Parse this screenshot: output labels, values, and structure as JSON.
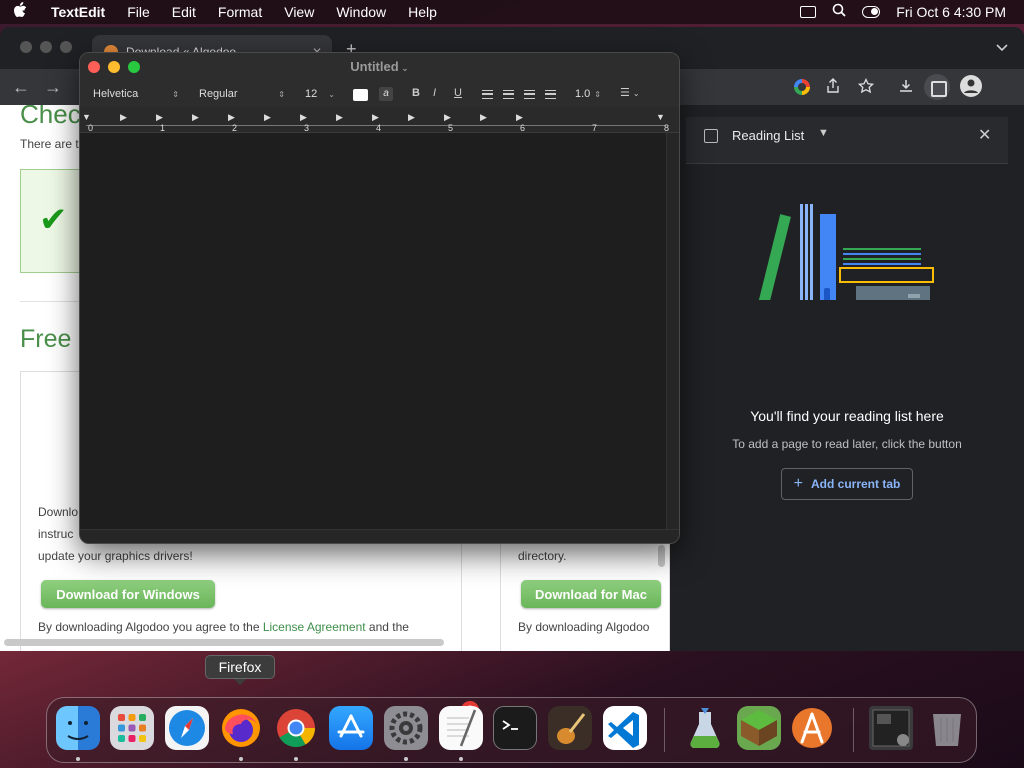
{
  "menubar": {
    "apple_icon": "apple-icon",
    "app_name": "TextEdit",
    "menus": [
      "File",
      "Edit",
      "Format",
      "View",
      "Window",
      "Help"
    ],
    "clock": "Fri Oct 6  4:30 PM"
  },
  "chrome": {
    "tab_title": "Download « Algodoo",
    "tab_close": "✕",
    "new_tab": "+"
  },
  "page": {
    "heading_check": "Chec",
    "para_there": "There are t",
    "heading_free": "Free",
    "win_text_1": "Downlo",
    "win_text_2": "instruc",
    "win_text_3": "update your graphics drivers!",
    "mac_text": "directory.",
    "download_windows": "Download for Windows",
    "download_mac": "Download for Mac",
    "agree_prefix": "By downloading Algodoo you agree to the ",
    "agree_link": "License Agreement",
    "agree_suffix": " and the",
    "agree_mac": "By downloading Algodoo"
  },
  "reading_list": {
    "title": "Reading List",
    "empty_title": "You'll find your reading list here",
    "empty_sub": "To add a page to read later, click the button",
    "add_button": "Add current tab",
    "colors": {
      "green": "#34a853",
      "blue": "#4285f4",
      "yellow": "#fbbc04",
      "grey": "#5f7380"
    }
  },
  "textedit": {
    "title": "Untitled",
    "font_family": "Helvetica",
    "font_style": "Regular",
    "font_size": "12",
    "highlight_glyph": "a",
    "bold": "B",
    "italic": "I",
    "underline": "U",
    "line_spacing": "1.0",
    "ruler_numbers": [
      "0",
      "1",
      "2",
      "3",
      "4",
      "5",
      "6",
      "7",
      "8"
    ]
  },
  "tooltip": {
    "text": "Firefox"
  },
  "dock": {
    "badge_count": "2",
    "apps": [
      "finder-icon",
      "launchpad-icon",
      "safari-icon",
      "firefox-icon",
      "chrome-icon",
      "app-store-icon",
      "system-settings-icon",
      "textedit-icon",
      "terminal-icon",
      "garageband-icon",
      "vscode-icon",
      "python-launcher-icon",
      "minecraft-icon",
      "algodoo-icon",
      "downloads-stack-icon",
      "trash-icon"
    ]
  }
}
